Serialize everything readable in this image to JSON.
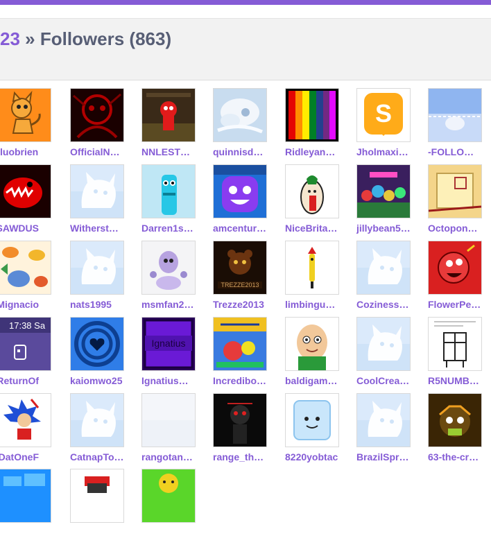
{
  "header": {
    "breadcrumb_user": "23",
    "separator": " » ",
    "title": "Followers (863)"
  },
  "colors": {
    "accent": "#855cd6",
    "text": "#575e75"
  },
  "followers": [
    {
      "name": "luobrien",
      "avatar": "scratch-cat-orange-icon"
    },
    {
      "name": "OfficialN…",
      "avatar": "red-drawing-icon"
    },
    {
      "name": "NNLEST…",
      "avatar": "red-character-icon"
    },
    {
      "name": "quinnisd…",
      "avatar": "cloud-art-icon"
    },
    {
      "name": "Ridleyan…",
      "avatar": "rainbow-stripes-icon"
    },
    {
      "name": "Jholmaxi…",
      "avatar": "scratch-logo-icon"
    },
    {
      "name": "-FOLLO…",
      "avatar": "sky-scene-icon"
    },
    {
      "name": "SAWDUS…",
      "avatar": "red-creature-icon"
    },
    {
      "name": "Witherst…",
      "avatar": "default-cat-icon"
    },
    {
      "name": "Darren1s…",
      "avatar": "cyan-character-icon"
    },
    {
      "name": "amcentur…",
      "avatar": "purple-face-icon"
    },
    {
      "name": "NiceBrita…",
      "avatar": "pickle-character-icon"
    },
    {
      "name": "jillybean5…",
      "avatar": "crowd-characters-icon"
    },
    {
      "name": "Octopon…",
      "avatar": "paper-card-icon"
    },
    {
      "name": "Mignacio…",
      "avatar": "fish-pattern-icon"
    },
    {
      "name": "nats1995",
      "avatar": "default-cat-icon"
    },
    {
      "name": "msmfan2…",
      "avatar": "ghost-character-icon"
    },
    {
      "name": "Trezze2013",
      "avatar": "dark-bear-icon"
    },
    {
      "name": "limbingu…",
      "avatar": "small-figure-icon"
    },
    {
      "name": "Coziness…",
      "avatar": "default-cat-icon"
    },
    {
      "name": "FlowerPe…",
      "avatar": "red-ball-character-icon"
    },
    {
      "name": "ReturnOf…",
      "avatar": "phone-screenshot-icon"
    },
    {
      "name": "kaiomwo25",
      "avatar": "blue-heart-icon"
    },
    {
      "name": "Ignatius…",
      "avatar": "purple-sign-icon"
    },
    {
      "name": "Incredibo…",
      "avatar": "colorful-logo-icon"
    },
    {
      "name": "baldigam…",
      "avatar": "bald-face-icon"
    },
    {
      "name": "CoolCrea…",
      "avatar": "default-cat-icon"
    },
    {
      "name": "R5NUMB…",
      "avatar": "sketch-drawing-icon"
    },
    {
      "name": "DatOneF…",
      "avatar": "blue-hedgehog-icon"
    },
    {
      "name": "CatnapTo…",
      "avatar": "default-cat-icon"
    },
    {
      "name": "rangotan…",
      "avatar": "blank-avatar-icon"
    },
    {
      "name": "range_th…",
      "avatar": "dark-figure-icon"
    },
    {
      "name": "8220yobtac",
      "avatar": "ice-cube-icon"
    },
    {
      "name": "BrazilSpr…",
      "avatar": "default-cat-icon"
    },
    {
      "name": "63-the-cr…",
      "avatar": "dark-creature-icon"
    },
    {
      "name": "",
      "avatar": "windows-logo-icon"
    },
    {
      "name": "",
      "avatar": "robot-figure-icon"
    },
    {
      "name": "",
      "avatar": "green-face-icon"
    }
  ]
}
